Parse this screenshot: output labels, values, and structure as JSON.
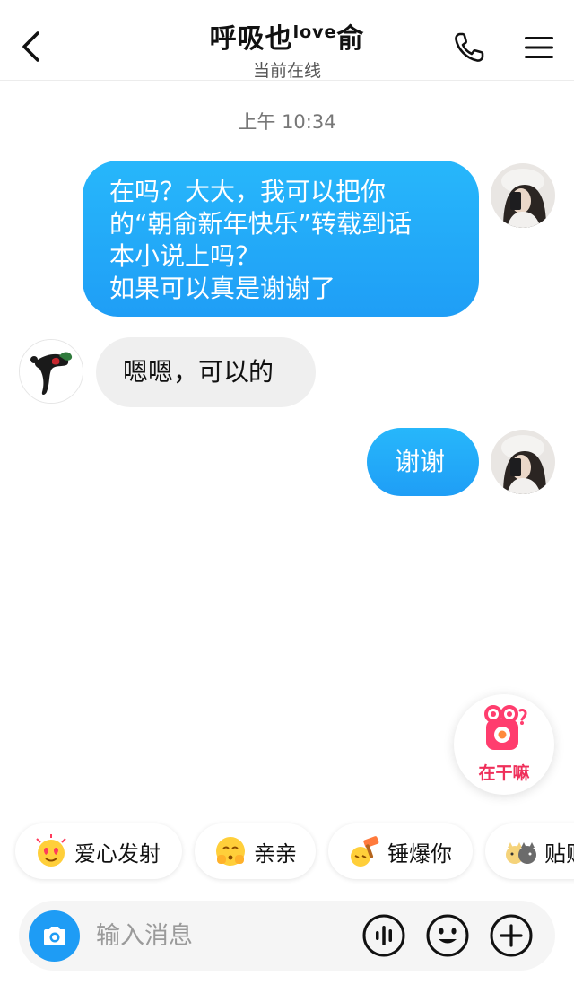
{
  "header": {
    "title_main": "呼吸也",
    "title_sup": "love",
    "title_end": "俞",
    "subtitle": "当前在线",
    "back_icon": "chevron-left-icon",
    "call_icon": "phone-icon",
    "menu_icon": "hamburger-menu-icon"
  },
  "chat": {
    "timestamp": "上午 10:34",
    "messages": [
      {
        "from": "me",
        "lines": [
          "在吗？大大，我可以把你",
          "的“朝俞新年快乐”转载到话",
          "本小说上吗？",
          "如果可以真是谢谢了"
        ]
      },
      {
        "from": "them",
        "lines": [
          "嗯嗯，可以的"
        ]
      },
      {
        "from": "me",
        "lines": [
          "谢谢"
        ]
      }
    ]
  },
  "floating": {
    "label": "在干嘛",
    "accent": "#ef2f5a"
  },
  "quick_replies": [
    {
      "label": "爱心发射",
      "icon": "heart-face-emoji-icon"
    },
    {
      "label": "亲亲",
      "icon": "kiss-face-emoji-icon"
    },
    {
      "label": "锤爆你",
      "icon": "hammer-emoji-icon"
    },
    {
      "label": "贴贴",
      "icon": "cuddle-emoji-icon"
    }
  ],
  "input": {
    "placeholder": "输入消息",
    "camera_icon": "camera-icon",
    "voice_icon": "voice-wave-icon",
    "emoji_icon": "smiley-icon",
    "plus_icon": "plus-circle-icon"
  },
  "colors": {
    "out_bubble": "#1f9ef6",
    "in_bubble": "#efefef",
    "camera_button": "#1e9cf5"
  }
}
